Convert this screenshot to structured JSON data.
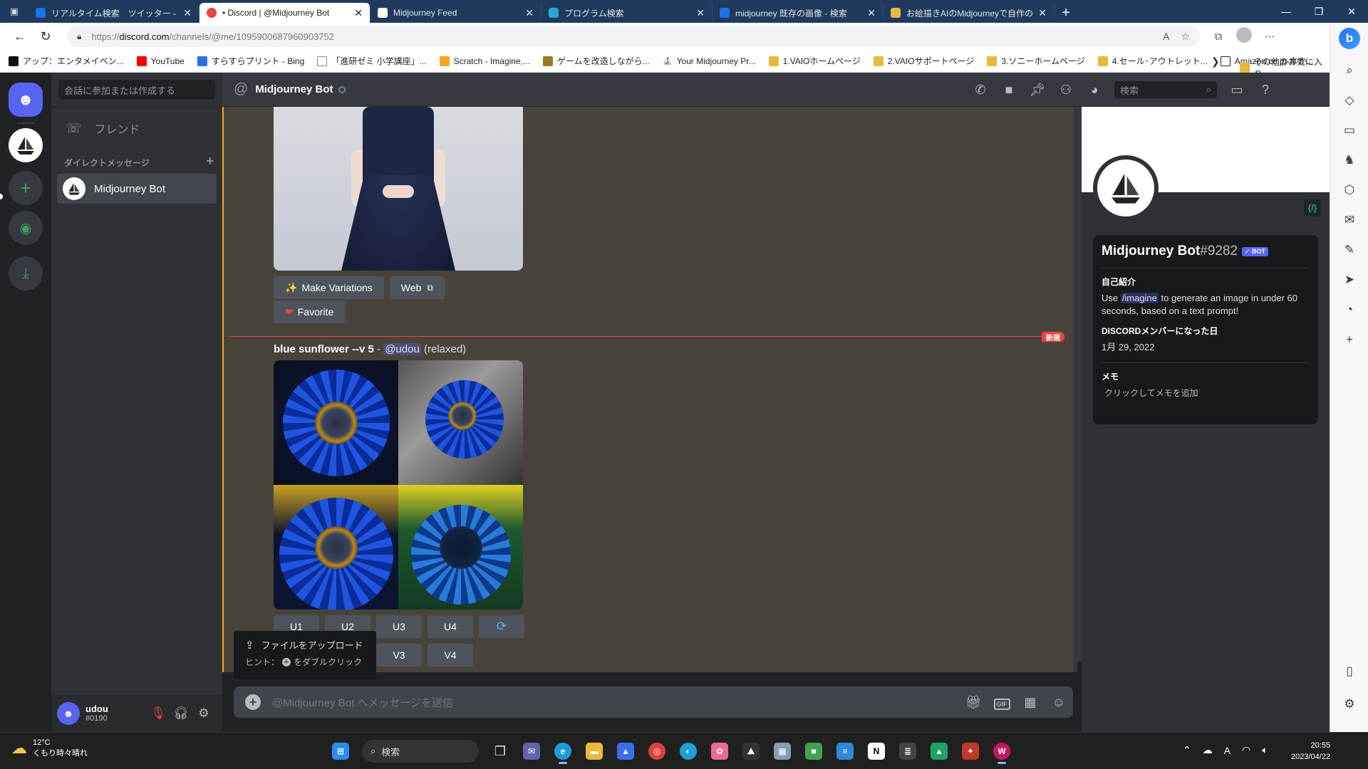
{
  "browser": {
    "tabs": [
      {
        "title": "リアルタイム検索　ツイッター - 検索",
        "active": false,
        "color": "#1a73e8"
      },
      {
        "title": "• Discord | @Midjourney Bot",
        "active": true,
        "color": "#e8453c"
      },
      {
        "title": "Midjourney Feed",
        "active": false,
        "color": "#ffffff"
      },
      {
        "title": "プログラム検索",
        "active": false,
        "color": "#2aa3d8"
      },
      {
        "title": "midjourney 既存の画像 - 検索",
        "active": false,
        "color": "#1a73e8"
      },
      {
        "title": "お絵描きAIのMidjourneyで自作の",
        "active": false,
        "color": "#e8b93c"
      }
    ],
    "url_prefix": "https://",
    "url_domain": "discord.com",
    "url_path": "/channels/@me/1095900687960903752",
    "bookmarks": [
      {
        "label": "アップ：エンタメイベン...",
        "color": "#111111"
      },
      {
        "label": "YouTube",
        "color": "#ff0000"
      },
      {
        "label": "すらすらプリント - Bing",
        "color": "#2a6ff0"
      },
      {
        "label": "「進研ゼミ 小学講座」...",
        "color": "#888888"
      },
      {
        "label": "Scratch - Imagine,...",
        "color": "#f6a623"
      },
      {
        "label": "ゲームを改造しながら...",
        "color": "#9a7b2a"
      },
      {
        "label": "Your Midjourney Pr...",
        "color": "#555555"
      },
      {
        "label": "1.VAIOホームページ",
        "color": "#e8b93c"
      },
      {
        "label": "2.VAIOサポートページ",
        "color": "#e8b93c"
      },
      {
        "label": "3.ソニーホームページ",
        "color": "#e8b93c"
      },
      {
        "label": "4.セール･アウトレット...",
        "color": "#e8b93c"
      },
      {
        "label": "Amazon.co.jp-本か...",
        "color": "#222222"
      }
    ],
    "bookmarks_other": "その他のお気に入り"
  },
  "discord": {
    "dm_search_placeholder": "会話に参加または作成する",
    "friends_label": "フレンド",
    "dm_header": "ダイレクトメッセージ",
    "dm_items": [
      {
        "name": "Midjourney Bot"
      }
    ],
    "user": {
      "name": "udou",
      "tag": "#0190"
    },
    "channel_title": "Midjourney Bot",
    "header_search_placeholder": "検索",
    "buttons": {
      "make_variations": "Make Variations",
      "web": "Web",
      "favorite": "Favorite"
    },
    "new_tag": "新規",
    "prompt": {
      "text": "blue sunflower --v 5",
      "sep": " - ",
      "mention": "@udou",
      "mode": " (relaxed)"
    },
    "upscale_buttons": [
      "U1",
      "U2",
      "U3",
      "U4"
    ],
    "variation_buttons": [
      "V3",
      "V4"
    ],
    "upload_tip": {
      "title": "ファイルをアップロード",
      "hint_prefix": "ヒント：",
      "hint_suffix": "をダブルクリック"
    },
    "composer_placeholder": "@Midjourney Bot へメッセージを送信",
    "profile": {
      "name": "Midjourney Bot",
      "discriminator": "#9282",
      "badge": "✓ BOT",
      "about_label": "自己紹介",
      "about_pre": "Use ",
      "about_cmd": "/imagine",
      "about_post": " to generate an image in under 60 seconds, based on a text prompt!",
      "member_since_label": "DISCORDメンバーになった日",
      "member_since": "1月 29, 2022",
      "memo_label": "メモ",
      "memo_placeholder": "クリックしてメモを追加"
    }
  },
  "taskbar": {
    "weather_temp": "12°C",
    "weather_desc": "くもり時々晴れ",
    "search": "検索",
    "time": "20:55",
    "date": "2023/04/22"
  },
  "colors": {
    "discord_blurple": "#5865f2",
    "discord_green": "#3ba55d",
    "new_red": "#ed4245",
    "highlight": "#faa81a"
  }
}
